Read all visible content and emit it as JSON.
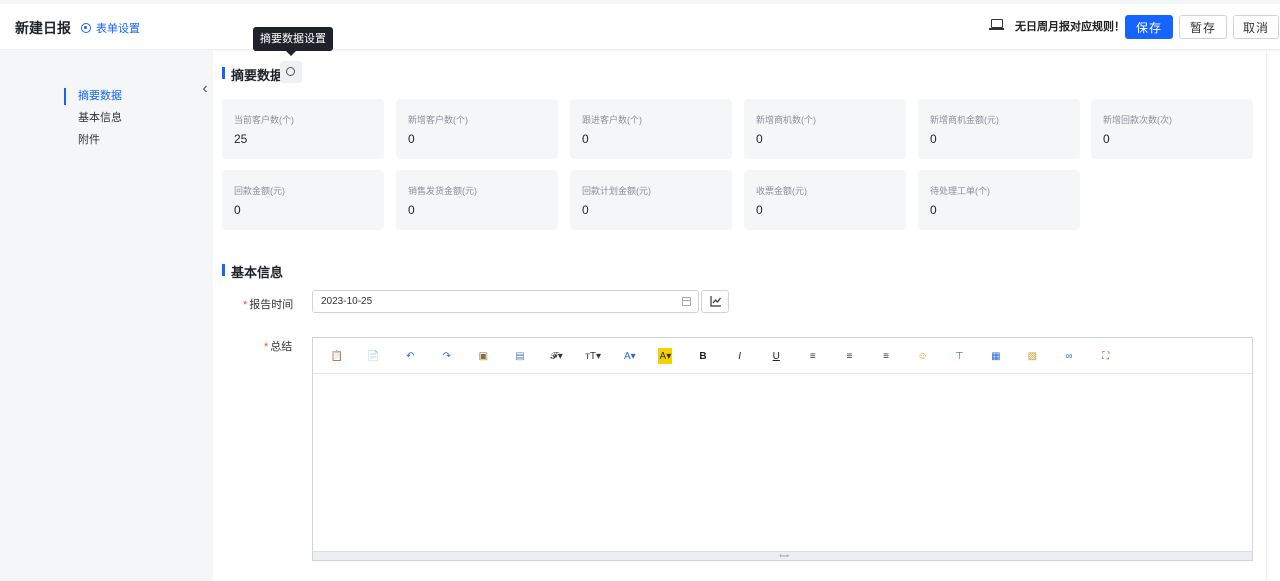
{
  "header": {
    "title": "新建日报",
    "form_settings": "表单设置",
    "rule_text": "无日周月报对应规则！",
    "save_label": "保存",
    "draft_label": "暂存",
    "cancel_label": "取消"
  },
  "tooltip": "摘要数据设置",
  "side_nav": {
    "items": [
      {
        "label": "摘要数据",
        "active": true
      },
      {
        "label": "基本信息",
        "active": false
      },
      {
        "label": "附件",
        "active": false
      }
    ]
  },
  "summary": {
    "title": "摘要数据",
    "cards": [
      {
        "label": "当前客户数(个)",
        "value": "25"
      },
      {
        "label": "新增客户数(个)",
        "value": "0"
      },
      {
        "label": "跟进客户数(个)",
        "value": "0"
      },
      {
        "label": "新增商机数(个)",
        "value": "0"
      },
      {
        "label": "新增商机金额(元)",
        "value": "0"
      },
      {
        "label": "新增回款次数(次)",
        "value": "0"
      },
      {
        "label": "回款金额(元)",
        "value": "0"
      },
      {
        "label": "销售发货金额(元)",
        "value": "0"
      },
      {
        "label": "回款计划金额(元)",
        "value": "0"
      },
      {
        "label": "收票金额(元)",
        "value": "0"
      },
      {
        "label": "待处理工单(个)",
        "value": "0"
      }
    ]
  },
  "basic": {
    "title": "基本信息",
    "report_time_label": "报告时间",
    "report_time_value": "2023-10-25",
    "summary_label": "总结"
  },
  "editor": {
    "toolbar": [
      {
        "icon": "paste-icon",
        "glyph": "📋",
        "color": "#555"
      },
      {
        "icon": "paste-text-icon",
        "glyph": "📄",
        "color": "#d4a017"
      },
      {
        "icon": "undo-icon",
        "glyph": "↶",
        "color": "#2d6ccf"
      },
      {
        "icon": "redo-icon",
        "glyph": "↷",
        "color": "#2d6ccf"
      },
      {
        "icon": "copy-format-icon",
        "glyph": "▣",
        "color": "#8a6d3b"
      },
      {
        "icon": "clear-format-icon",
        "glyph": "▤",
        "color": "#5a7fb0"
      },
      {
        "icon": "font-family-icon",
        "glyph": "𝓕▾",
        "color": "#333"
      },
      {
        "icon": "font-size-icon",
        "glyph": "ᴛT▾",
        "color": "#333"
      },
      {
        "icon": "font-color-icon",
        "glyph": "A▾",
        "color": "#2d6ccf"
      },
      {
        "icon": "highlight-icon",
        "glyph": "A▾",
        "color": "#333"
      },
      {
        "icon": "bold-icon",
        "glyph": "B",
        "color": "#222"
      },
      {
        "icon": "italic-icon",
        "glyph": "I",
        "color": "#222"
      },
      {
        "icon": "underline-icon",
        "glyph": "U",
        "color": "#222"
      },
      {
        "icon": "align-left-icon",
        "glyph": "≡",
        "color": "#333"
      },
      {
        "icon": "align-center-icon",
        "glyph": "≡",
        "color": "#333"
      },
      {
        "icon": "align-right-icon",
        "glyph": "≡",
        "color": "#333"
      },
      {
        "icon": "emoji-icon",
        "glyph": "☺",
        "color": "#e0a800"
      },
      {
        "icon": "horizontal-rule-icon",
        "glyph": "⊤",
        "color": "#2e8b57"
      },
      {
        "icon": "table-icon",
        "glyph": "▦",
        "color": "#2d6ccf"
      },
      {
        "icon": "image-icon",
        "glyph": "▧",
        "color": "#c89b2c"
      },
      {
        "icon": "link-icon",
        "glyph": "∞",
        "color": "#2d6ccf"
      },
      {
        "icon": "fullscreen-icon",
        "glyph": "⛶",
        "color": "#c0392b"
      }
    ],
    "resize_glyph": "⟺"
  },
  "colors": {
    "accent": "#1664ff",
    "required": "#f54a45"
  }
}
